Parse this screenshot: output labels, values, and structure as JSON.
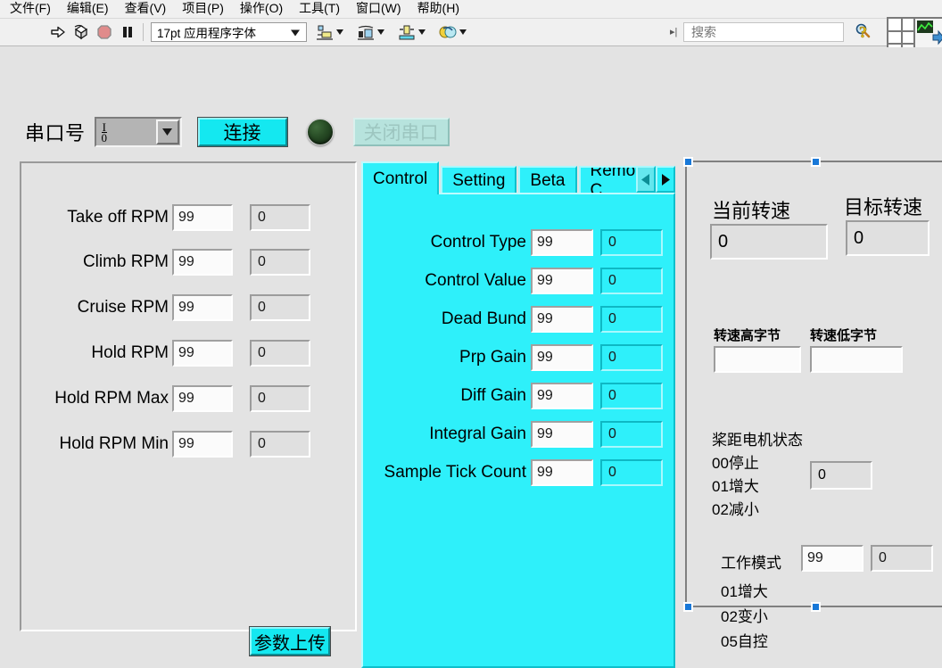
{
  "menubar": {
    "items": [
      {
        "label": "文件(F)",
        "name": "menu-file"
      },
      {
        "label": "编辑(E)",
        "name": "menu-edit"
      },
      {
        "label": "查看(V)",
        "name": "menu-view"
      },
      {
        "label": "项目(P)",
        "name": "menu-project"
      },
      {
        "label": "操作(O)",
        "name": "menu-operate"
      },
      {
        "label": "工具(T)",
        "name": "menu-tools"
      },
      {
        "label": "窗口(W)",
        "name": "menu-window"
      },
      {
        "label": "帮助(H)",
        "name": "menu-help"
      }
    ]
  },
  "toolbar": {
    "run_icon": "run-arrow-icon",
    "run_continuous_icon": "run-continuously-icon",
    "abort_icon": "abort-execution-icon",
    "pause_icon": "pause-icon",
    "font_value": "17pt 应用程序字体",
    "align_icon": "align-objects-icon",
    "distribute_icon": "distribute-objects-icon",
    "resize_icon": "resize-objects-icon",
    "reorder_icon": "reorder-objects-icon",
    "search_placeholder": "搜索",
    "search_value": "",
    "search_icon": "magnifier-icon",
    "help_icon": "question-mark-help-icon",
    "grid_icon": "grid-palette-icon",
    "palette_icon": "controls-palette-icon"
  },
  "serial": {
    "label": "串口号",
    "refnum_glyph": "I/O",
    "refnum_value": "",
    "connect_label": "连接",
    "led_name": "connection-led",
    "close_label": "关闭串口"
  },
  "left_panel": {
    "rows": [
      {
        "label": "Take off RPM",
        "input": "99",
        "indicator": "0"
      },
      {
        "label": "Climb RPM",
        "input": "99",
        "indicator": "0"
      },
      {
        "label": "Cruise RPM",
        "input": "99",
        "indicator": "0"
      },
      {
        "label": "Hold RPM",
        "input": "99",
        "indicator": "0"
      },
      {
        "label": "Hold RPM Max",
        "input": "99",
        "indicator": "0"
      },
      {
        "label": "Hold RPM Min",
        "input": "99",
        "indicator": "0"
      }
    ],
    "upload_label": "参数上传"
  },
  "tabs": {
    "items": [
      {
        "label": "Control",
        "active": true
      },
      {
        "label": "Setting",
        "active": false
      },
      {
        "label": "Beta",
        "active": false
      },
      {
        "label": "Remote C",
        "active": false
      }
    ],
    "prev_icon": "tab-prev-arrow-icon",
    "next_icon": "tab-next-arrow-icon",
    "rows": [
      {
        "label": "Control Type",
        "input": "99",
        "indicator": "0"
      },
      {
        "label": "Control Value",
        "input": "99",
        "indicator": "0"
      },
      {
        "label": "Dead Bund",
        "input": "99",
        "indicator": "0"
      },
      {
        "label": "Prp Gain",
        "input": "99",
        "indicator": "0"
      },
      {
        "label": "Diff Gain",
        "input": "99",
        "indicator": "0"
      },
      {
        "label": "Integral Gain",
        "input": "99",
        "indicator": "0"
      },
      {
        "label": "Sample Tick Count",
        "input": "99",
        "indicator": "0"
      }
    ]
  },
  "right_panel": {
    "current_rpm_label": "当前转速",
    "current_rpm_value": "0",
    "target_rpm_label": "目标转速",
    "target_rpm_value": "0",
    "rpm_high_label": "转速高字节",
    "rpm_high_value": "",
    "rpm_low_label": "转速低字节",
    "rpm_low_value": "",
    "pitch_motor_title": "桨距电机状态",
    "pitch_motor_opts": [
      "00停止",
      "01增大",
      "02减小"
    ],
    "pitch_motor_value": "0",
    "work_mode_label": "工作模式",
    "work_mode_input": "99",
    "work_mode_indicator": "0",
    "work_mode_opts": [
      "01增大",
      "02变小",
      "05自控"
    ]
  },
  "colors": {
    "cyan": "#2ef0fa",
    "button_cyan": "#14e8f0",
    "panel_gray": "#e3e3e3",
    "selection_blue": "#1878d8"
  }
}
